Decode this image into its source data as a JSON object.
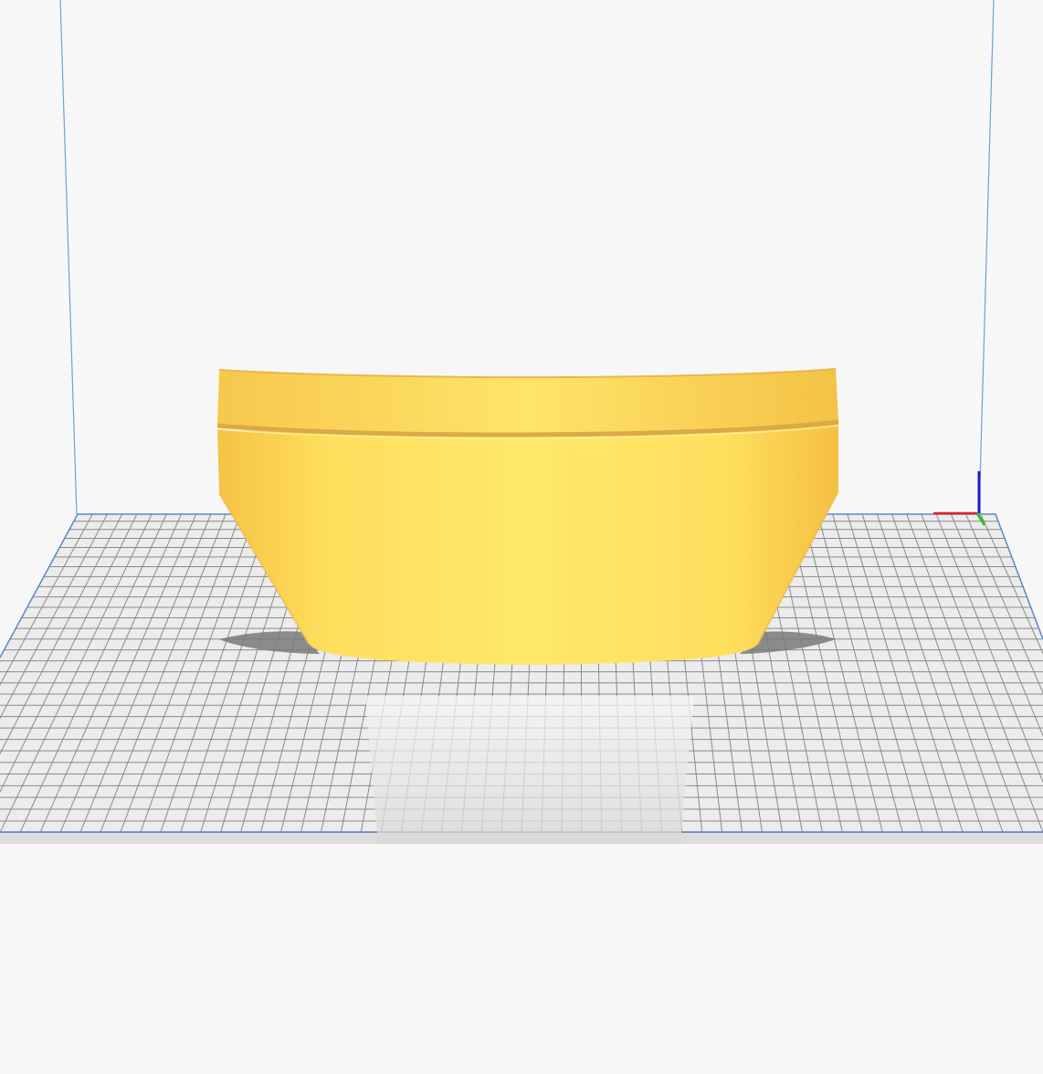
{
  "viewport": {
    "background_color": "#f7f7f7",
    "build_plate": {
      "grid_color": "#8a8a8a",
      "plate_color": "#ececec",
      "edge_color": "#c8c8c8",
      "border_color": "#5b87c8"
    },
    "build_volume": {
      "line_color": "#6fa0d8"
    },
    "model": {
      "name": "bowl",
      "color": "#ffe066",
      "shade_color": "#f2c24a",
      "groove_color": "#d9aa45"
    },
    "axis_gizmo": {
      "x_color": "#e02020",
      "y_color": "#22c322",
      "z_color": "#1a1acc"
    }
  }
}
